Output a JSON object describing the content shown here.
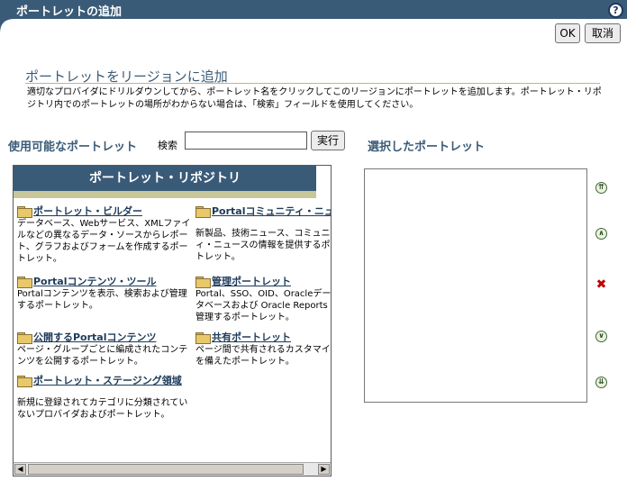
{
  "header": {
    "title": "ポートレットの追加",
    "help_icon": "help-icon",
    "help_label": "?"
  },
  "actions": {
    "ok_label": "OK",
    "cancel_label": "取消"
  },
  "section": {
    "title": "ポートレットをリージョンに追加",
    "instructions": "適切なプロバイダにドリルダウンしてから、ポートレット名をクリックしてこのリージョンにポートレットを追加します。ポートレット・リポジトリ内でのポートレットの場所がわからない場合は、「検索」フィールドを使用してください。"
  },
  "available": {
    "label": "使用可能なポートレット",
    "search_label": "検索",
    "search_value": "",
    "run_label": "実行"
  },
  "repository": {
    "title": "ポートレット・リポジトリ",
    "items": [
      {
        "name": "ポートレット・ビルダー",
        "desc": "データベース、Webサービス、XMLファイルなどの異なるデータ・ソースからレポート、グラフおよびフォームを作成するポートレット。"
      },
      {
        "name": "Portalコミュニティ・ニュース",
        "desc": "新製品、技術ニュース、コミュニティ・ニュースの情報を提供するポートレット。"
      },
      {
        "name": "Portalコンテンツ・ツール",
        "desc": "Portalコンテンツを表示、検索および管理するポートレット。"
      },
      {
        "name": "管理ポートレット",
        "desc": "Portal、SSO、OID、Oracleデータベースおよび Oracle Reports を管理するポートレット。"
      },
      {
        "name": "公開するPortalコンテンツ",
        "desc": "ページ・グループごとに編成されたコンテンツを公開するポートレット。"
      },
      {
        "name": "共有ポートレット",
        "desc": "ページ間で共有されるカスタマイズを備えたポートレット。"
      },
      {
        "name": "ポートレット・ステージング領域",
        "desc": "新規に登録されてカテゴリに分類されていないプロバイダおよびポートレット。"
      }
    ]
  },
  "scrollbar": {
    "left_arrow": "◀",
    "right_arrow": "▶"
  },
  "selected": {
    "label": "選択したポートレット"
  },
  "controls": {
    "move_top": "⇈",
    "move_up": "∧",
    "delete": "✖",
    "move_down": "∨",
    "move_bottom": "⇊"
  },
  "colors": {
    "title_bar": "#3a5b78",
    "accent_rule": "#c5b57a",
    "link": "#1d3a5a"
  }
}
